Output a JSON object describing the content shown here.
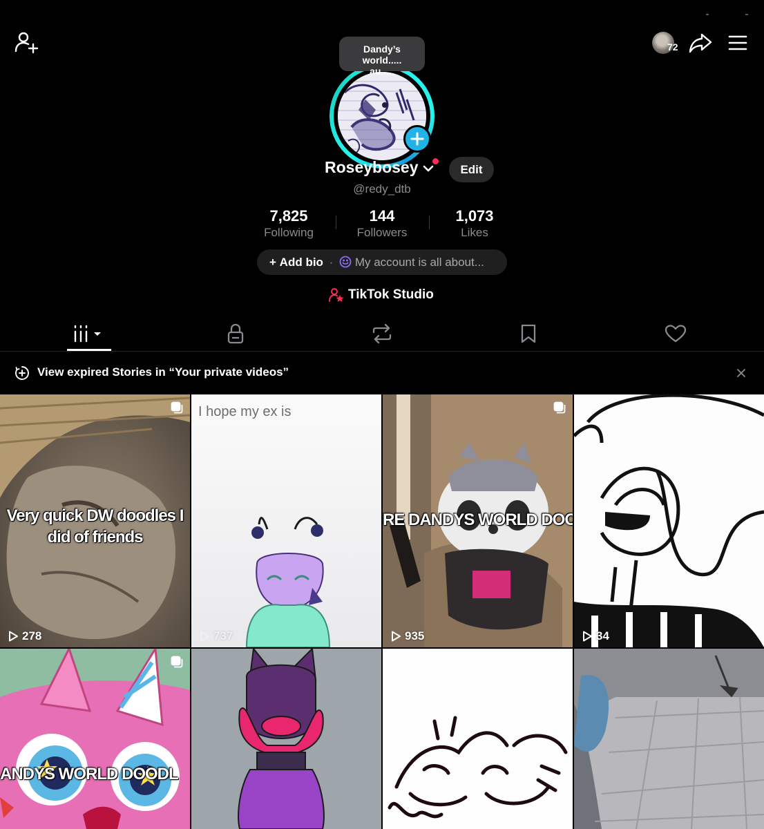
{
  "header": {
    "viewer_count": "72"
  },
  "profile": {
    "note_bubble": "Dandy’s world..... au.....",
    "display_name": "Roseybosey",
    "username": "@redy_dtb",
    "edit_label": "Edit",
    "stats": [
      {
        "value": "7,825",
        "label": "Following"
      },
      {
        "value": "144",
        "label": "Followers"
      },
      {
        "value": "1,073",
        "label": "Likes"
      }
    ],
    "bio": {
      "add_label": "Add bio",
      "separator": "·",
      "prompt": "My account is all about..."
    },
    "studio_label": "TikTok Studio"
  },
  "banner": {
    "text": "View expired Stories in “Your private videos”"
  },
  "grid": [
    {
      "caption": "Very quick DW doodles I did of friends",
      "views": "278",
      "multi": true
    },
    {
      "caption": "I hope my ex is",
      "views": "737",
      "multi": false
    },
    {
      "caption": "RE DANDYS WORLD DOOD",
      "views": "935",
      "multi": true
    },
    {
      "caption": "",
      "views": "34",
      "multi": false
    },
    {
      "caption": "ANDYS WORLD DOODL",
      "views": "",
      "multi": true
    },
    {
      "caption": "",
      "views": "",
      "multi": false
    },
    {
      "caption": "",
      "views": "",
      "multi": false
    },
    {
      "caption": "",
      "views": "",
      "multi": false
    }
  ],
  "colors": {
    "background": "#000000",
    "accent_ring": "#25f4ee",
    "add_badge": "#20b3e8",
    "notification": "#fe2c55",
    "muted_text": "#8a8b91"
  }
}
